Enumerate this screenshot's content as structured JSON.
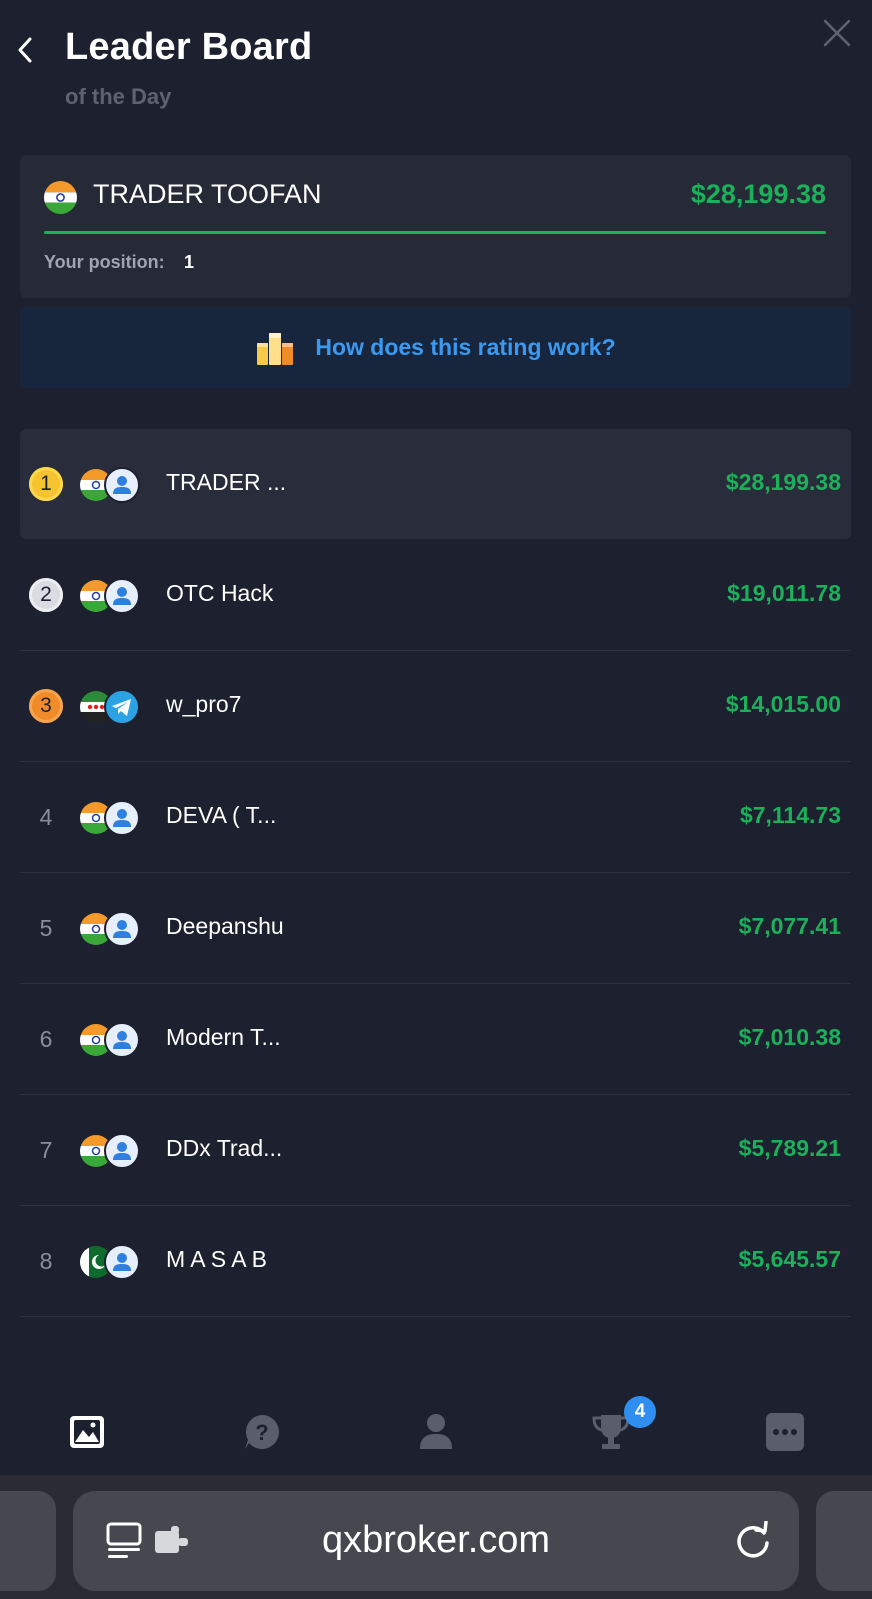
{
  "header": {
    "title": "Leader Board",
    "subtitle": "of the Day"
  },
  "user": {
    "name": "TRADER TOOFAN",
    "amount": "$28,199.38",
    "position_label": "Your position:",
    "position_value": "1"
  },
  "banner": {
    "text": "How does this rating work?"
  },
  "leaderboard": [
    {
      "rank": "1",
      "name": "TRADER ...",
      "amount": "$28,199.38",
      "medal": "gold",
      "flag": "india",
      "avatar": "person"
    },
    {
      "rank": "2",
      "name": "OTC Hack",
      "amount": "$19,011.78",
      "medal": "silver",
      "flag": "india",
      "avatar": "person"
    },
    {
      "rank": "3",
      "name": "w_pro7",
      "amount": "$14,015.00",
      "medal": "bronze",
      "flag": "syria",
      "avatar": "telegram"
    },
    {
      "rank": "4",
      "name": "DEVA ( T...",
      "amount": "$7,114.73",
      "medal": "",
      "flag": "india",
      "avatar": "person"
    },
    {
      "rank": "5",
      "name": "Deepanshu",
      "amount": "$7,077.41",
      "medal": "",
      "flag": "india",
      "avatar": "person"
    },
    {
      "rank": "6",
      "name": "Modern T...",
      "amount": "$7,010.38",
      "medal": "",
      "flag": "india",
      "avatar": "person"
    },
    {
      "rank": "7",
      "name": "DDx Trad...",
      "amount": "$5,789.21",
      "medal": "",
      "flag": "india",
      "avatar": "person"
    },
    {
      "rank": "8",
      "name": "M A S A B",
      "amount": "$5,645.57",
      "medal": "",
      "flag": "pakistan",
      "avatar": "person"
    }
  ],
  "nav": {
    "items": [
      "chart-icon",
      "help-icon",
      "profile-icon",
      "trophy-icon",
      "more-icon"
    ],
    "trophy_badge": "4"
  },
  "browser": {
    "url": "qxbroker.com"
  },
  "colors": {
    "background": "#1d202e",
    "card": "#262a37",
    "positive": "#1cb05a",
    "link": "#3a9af2",
    "banner": "#17263d"
  }
}
